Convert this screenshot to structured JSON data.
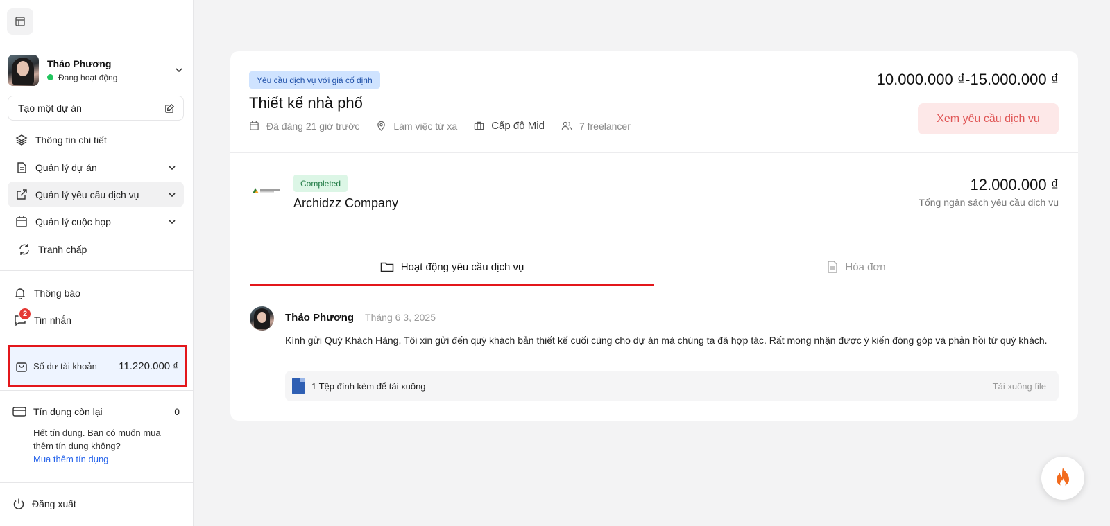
{
  "sidebar": {
    "profile": {
      "name": "Thảo Phương",
      "status": "Đang hoạt động"
    },
    "create_project": "Tạo một dự án",
    "nav": [
      {
        "label": "Thông tin chi tiết",
        "icon": "layers-icon"
      },
      {
        "label": "Quản lý dự án",
        "icon": "document-icon"
      },
      {
        "label": "Quản lý yêu cầu dịch vụ",
        "icon": "external-link-icon"
      },
      {
        "label": "Quản lý cuộc họp",
        "icon": "calendar-icon"
      },
      {
        "label": "Tranh chấp",
        "icon": "refresh-icon"
      }
    ],
    "notifications": "Thông báo",
    "messages": "Tin nhắn",
    "messages_count": "2",
    "balance": {
      "label": "Số dư tài khoản",
      "value": "11.220.000 ₫"
    },
    "credit": {
      "label": "Tín dụng còn lại",
      "value": "0",
      "note": "Hết tín dụng. Bạn có muốn mua thêm tín dụng không?",
      "link": "Mua thêm tín dụng"
    },
    "logout": "Đăng xuất"
  },
  "request": {
    "tag": "Yêu cầu dịch vụ với giá cố định",
    "title": "Thiết kế nhà phố",
    "posted": "Đã đăng 21 giờ trước",
    "location": "Làm việc từ xa",
    "level": "Cấp độ Mid",
    "freelancers": "7 freelancer",
    "price_range": "10.000.000 ₫-15.000.000 ₫",
    "view_button": "Xem yêu cầu dịch vụ"
  },
  "company": {
    "status": "Completed",
    "name": "Archidzz Company",
    "budget": "12.000.000 ₫",
    "budget_label": "Tổng ngân sách yêu cầu dịch vụ"
  },
  "tabs": [
    {
      "label": "Hoạt động yêu cầu dịch vụ",
      "active": true
    },
    {
      "label": "Hóa đơn",
      "active": false
    }
  ],
  "activity": {
    "author": "Thảo Phương",
    "date": "Tháng 6 3, 2025",
    "body": "Kính gửi Quý Khách Hàng, Tôi xin gửi đến quý khách bản thiết kế cuối cùng cho dự án mà chúng ta đã hợp tác. Rất mong nhận được ý kiến đóng góp và phản hồi từ quý khách.",
    "attachment_label": "1 Tệp đính kèm để tải xuống",
    "download_label": "Tải xuống file"
  },
  "colors": {
    "accent": "#e3161b",
    "link": "#2563eb",
    "tag_blue": "#cfe3ff",
    "tag_green": "#dcf6e6"
  }
}
